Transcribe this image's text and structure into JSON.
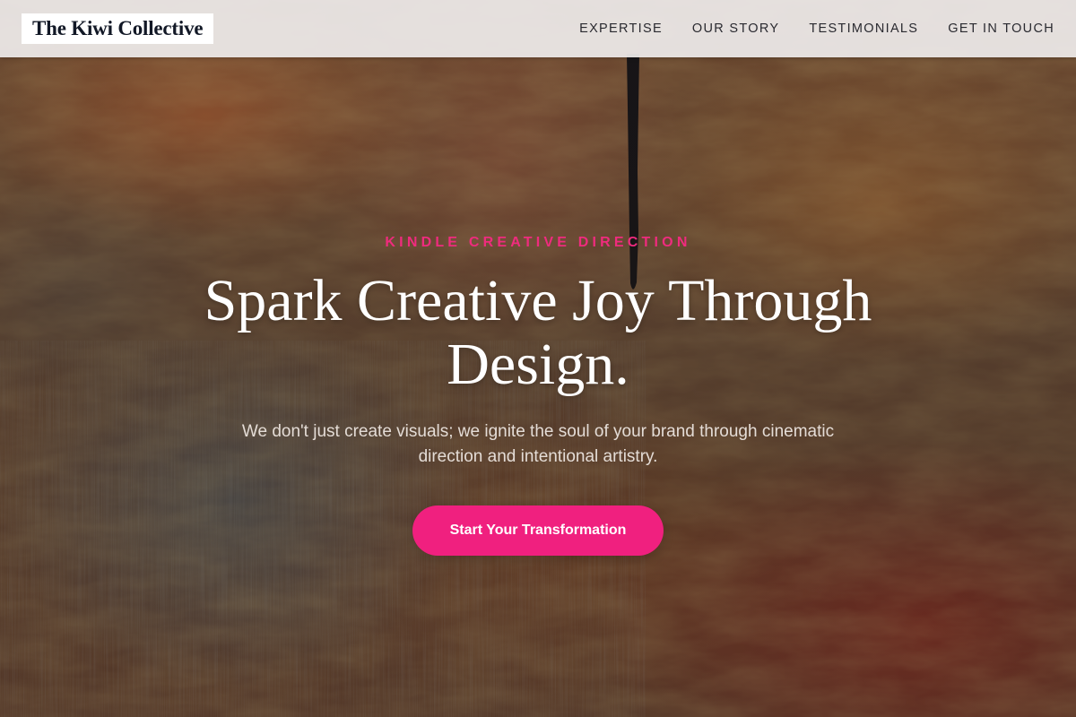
{
  "header": {
    "logo_text": "The Kiwi Collective",
    "nav": [
      {
        "label": "EXPERTISE"
      },
      {
        "label": "OUR STORY"
      },
      {
        "label": "TESTIMONIALS"
      },
      {
        "label": "GET IN TOUCH"
      }
    ]
  },
  "hero": {
    "eyebrow": "KINDLE CREATIVE DIRECTION",
    "headline": "Spark Creative Joy Through Design.",
    "subtext": "We don't just create visuals; we ignite the soul of your brand through cinematic direction and intentional artistry.",
    "cta_label": "Start Your Transformation",
    "background": "textured-oil-painting"
  },
  "colors": {
    "accent": "#f0207f",
    "eyebrow": "#ef2b7e",
    "header_bg": "#eceae8",
    "logo_text": "#121826",
    "headline": "#ffffff"
  }
}
